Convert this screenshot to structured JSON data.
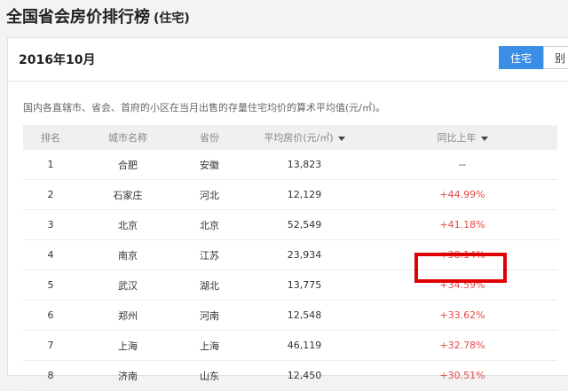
{
  "header": {
    "title": "全国省会房价排行榜",
    "subtitle": "(住宅)"
  },
  "panel": {
    "month": "2016年10月",
    "tabs": [
      {
        "label": "住宅",
        "active": true
      },
      {
        "label": "别",
        "active": false
      }
    ],
    "description": "国内各直辖市、省会、首府的小区在当月出售的存量住宅均价的算术平均值(元/㎡)。"
  },
  "table": {
    "columns": [
      "排名",
      "城市名称",
      "省份",
      "平均房价(元/㎡)",
      "同比上年"
    ],
    "rows": [
      {
        "rank": "1",
        "city": "合肥",
        "province": "安徽",
        "price": "13,823",
        "change": "--"
      },
      {
        "rank": "2",
        "city": "石家庄",
        "province": "河北",
        "price": "12,129",
        "change": "+44.99%"
      },
      {
        "rank": "3",
        "city": "北京",
        "province": "北京",
        "price": "52,549",
        "change": "+41.18%"
      },
      {
        "rank": "4",
        "city": "南京",
        "province": "江苏",
        "price": "23,934",
        "change": "+38.14%"
      },
      {
        "rank": "5",
        "city": "武汉",
        "province": "湖北",
        "price": "13,775",
        "change": "+34.59%"
      },
      {
        "rank": "6",
        "city": "郑州",
        "province": "河南",
        "price": "12,548",
        "change": "+33.62%"
      },
      {
        "rank": "7",
        "city": "上海",
        "province": "上海",
        "price": "46,119",
        "change": "+32.78%"
      },
      {
        "rank": "8",
        "city": "济南",
        "province": "山东",
        "price": "12,450",
        "change": "+30.51%"
      }
    ]
  },
  "colors": {
    "accent": "#3a8ee6",
    "positive_change": "#e54a4a",
    "highlight": "#e00000"
  }
}
